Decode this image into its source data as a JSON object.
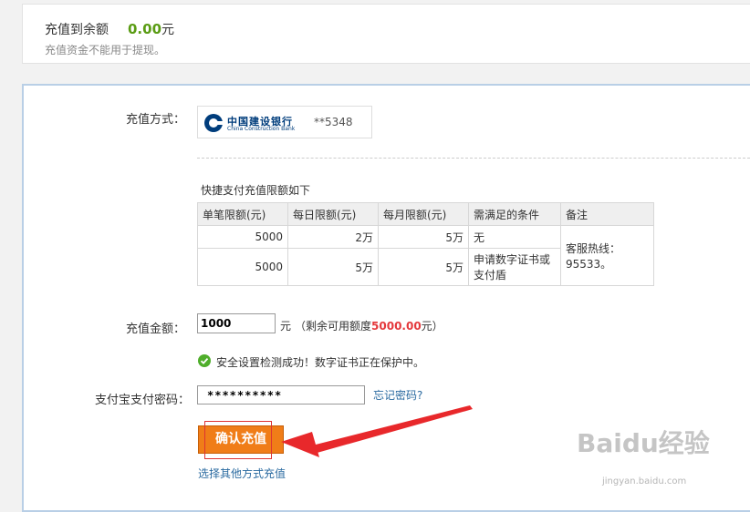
{
  "top": {
    "title": "充值到余额",
    "balance": "0.00",
    "balance_unit": "元",
    "note": "充值资金不能用于提现。"
  },
  "payment": {
    "label": "充值方式：",
    "bank_name_cn": "中国建设银行",
    "bank_name_en": "China Construction Bank",
    "card": "**5348"
  },
  "limits": {
    "title": "快捷支付充值限额如下",
    "headers": [
      "单笔限额(元)",
      "每日限额(元)",
      "每月限额(元)",
      "需满足的条件",
      "备注"
    ],
    "rows": [
      {
        "single": "5000",
        "daily": "2万",
        "monthly": "5万",
        "condition": "无"
      },
      {
        "single": "5000",
        "daily": "5万",
        "monthly": "5万",
        "condition": "申请数字证书或支付盾"
      }
    ],
    "remark": "客服热线：95533。"
  },
  "amount": {
    "label": "充值金额：",
    "value": "1000",
    "unit": "元",
    "remain_prefix": "（剩余可用额度",
    "remain_value": "5000.00",
    "remain_suffix": "元）"
  },
  "security": {
    "message": "安全设置检测成功！数字证书正在保护中。"
  },
  "password": {
    "label": "支付宝支付密码：",
    "value": "**********",
    "forgot": "忘记密码?"
  },
  "actions": {
    "confirm": "确认充值",
    "other": "选择其他方式充值"
  },
  "watermark": {
    "logo": "Baidu经验",
    "url": "jingyan.baidu.com"
  },
  "colors": {
    "accent": "#f07d18",
    "balance": "#5a9c14",
    "remain": "#e4393c",
    "link": "#2a6aa0"
  }
}
